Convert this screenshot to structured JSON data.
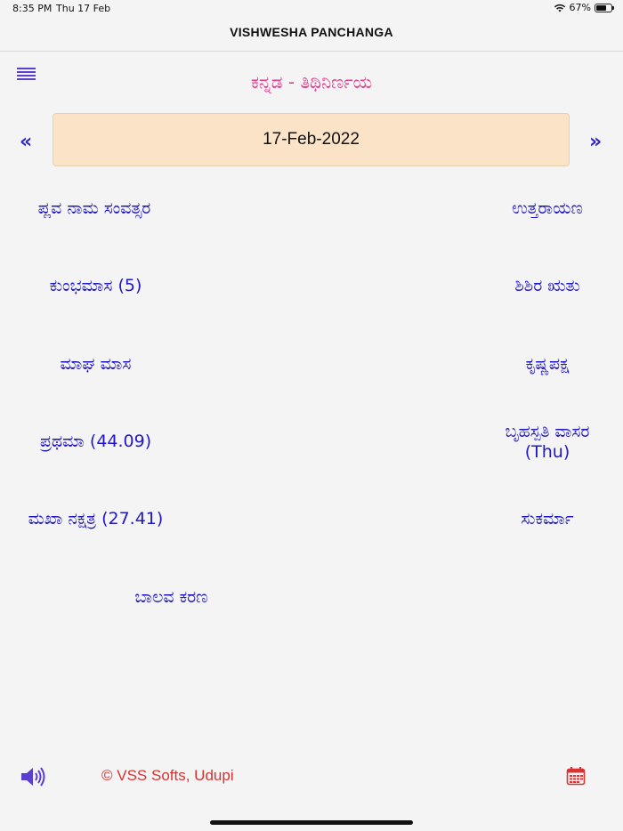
{
  "status": {
    "time": "8:35 PM",
    "date": "Thu 17 Feb",
    "battery_text": "67%",
    "battery_level": 0.67
  },
  "nav": {
    "title": "VISHWESHA PANCHANGA"
  },
  "header": {
    "language_title": "ಕನ್ನಡ - ತಿಥಿನಿರ್ಣಯ"
  },
  "date_nav": {
    "prev_label": "«",
    "current_date": "17-Feb-2022",
    "next_label": "»"
  },
  "panchanga": {
    "samvatsara": "ಪ್ಲವ ನಾಮ ಸಂವತ್ಸರ",
    "ayana": "ಉತ್ತರಾಯಣ",
    "saura_masa": "ಕುಂಭಮಾಸ (5)",
    "rutu": "ಶಿಶಿರ ಋತು",
    "chandra_masa": "ಮಾಘ ಮಾಸ",
    "paksha": "ಕೃಷ್ಣಪಕ್ಷ",
    "tithi": "ಪ್ರಥಮಾ (44.09)",
    "vasara": "ಬೃಹಸ್ಪತಿ ವಾಸರ",
    "vasara_short": "(Thu)",
    "nakshatra": "ಮಖಾ  ನಕ್ಷತ್ರ  (27.41)",
    "yoga": "ಸುಕರ್ಮಾ",
    "karana": "ಬಾಲವ  ಕರಣ"
  },
  "footer": {
    "credit": "© VSS Softs, Udupi"
  },
  "colors": {
    "accent_blue": "#2018c6",
    "title_pink": "#e03c8c",
    "date_box_bg": "#fbe3c8",
    "credit_red": "#d83232",
    "icon_purple": "#5b3fd0"
  },
  "icons": {
    "menu": "menu-icon",
    "speaker": "speaker-icon",
    "calendar": "calendar-icon"
  }
}
